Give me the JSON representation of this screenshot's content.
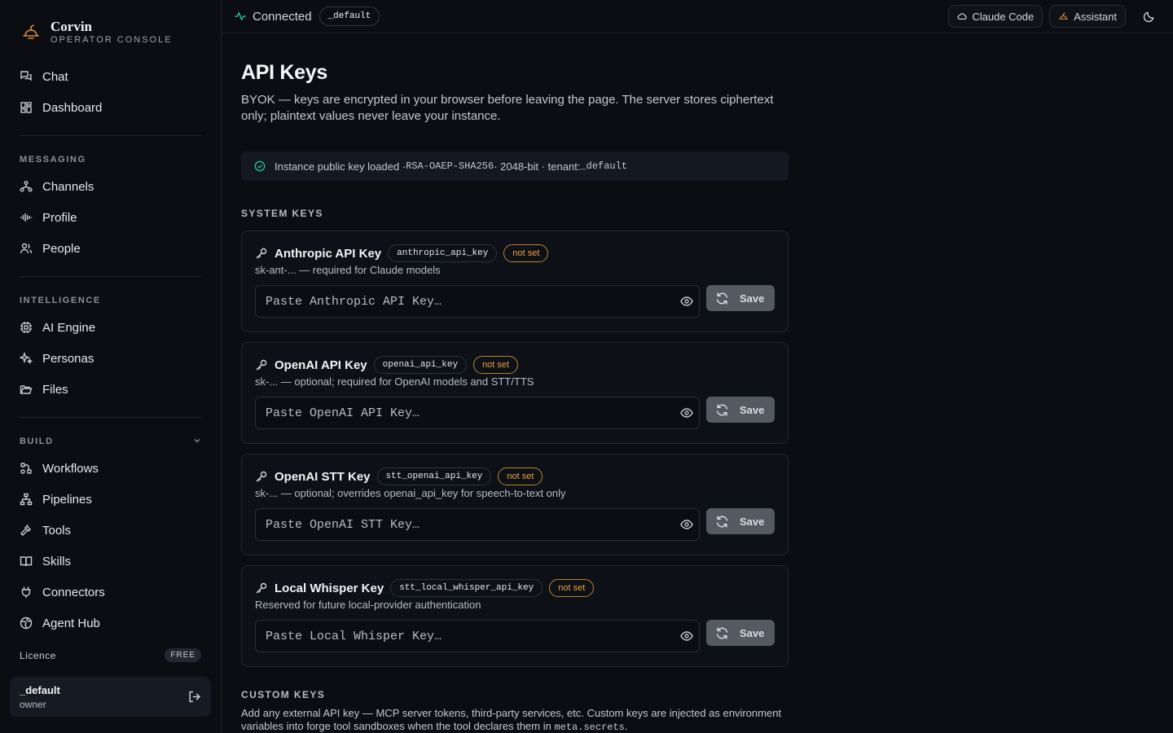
{
  "brand": {
    "name": "Corvin",
    "subtitle": "OPERATOR CONSOLE"
  },
  "sidebar": {
    "top_items": [
      {
        "label": "Chat",
        "icon": "chat-icon"
      },
      {
        "label": "Dashboard",
        "icon": "dashboard-icon"
      }
    ],
    "sections": [
      {
        "title": "MESSAGING",
        "items": [
          {
            "label": "Channels",
            "icon": "channels-icon"
          },
          {
            "label": "Profile",
            "icon": "waveform-icon"
          },
          {
            "label": "People",
            "icon": "people-icon"
          }
        ]
      },
      {
        "title": "INTELLIGENCE",
        "items": [
          {
            "label": "AI Engine",
            "icon": "chip-icon"
          },
          {
            "label": "Personas",
            "icon": "sparkles-icon"
          },
          {
            "label": "Files",
            "icon": "folder-icon"
          }
        ]
      },
      {
        "title": "BUILD",
        "items": [
          {
            "label": "Workflows",
            "icon": "workflow-icon"
          },
          {
            "label": "Pipelines",
            "icon": "pipeline-icon"
          },
          {
            "label": "Tools",
            "icon": "hammer-icon"
          },
          {
            "label": "Skills",
            "icon": "book-icon"
          },
          {
            "label": "Connectors",
            "icon": "plug-icon"
          },
          {
            "label": "Agent Hub",
            "icon": "globe-icon"
          }
        ]
      }
    ],
    "licence_label": "Licence",
    "licence_badge": "FREE",
    "user": {
      "name": "_default",
      "role": "owner"
    }
  },
  "topbar": {
    "status": "Connected",
    "tenant": "_default",
    "claude_code_label": "Claude Code",
    "assistant_label": "Assistant"
  },
  "page": {
    "title": "API Keys",
    "description": "BYOK — keys are encrypted in your browser before leaving the page. The server stores ciphertext only; plaintext values never leave your instance.",
    "notice_prefix": "Instance public key loaded · ",
    "notice_algo": "RSA-OAEP-SHA256",
    "notice_mid": " · 2048-bit · tenant: ",
    "notice_tenant": "_default",
    "system_keys_title": "SYSTEM KEYS",
    "keys": [
      {
        "name": "Anthropic API Key",
        "id": "anthropic_api_key",
        "status": "not set",
        "desc": "sk-ant-... — required for Claude models",
        "placeholder": "Paste Anthropic API Key…",
        "save": "Save"
      },
      {
        "name": "OpenAI API Key",
        "id": "openai_api_key",
        "status": "not set",
        "desc": "sk-... — optional; required for OpenAI models and STT/TTS",
        "placeholder": "Paste OpenAI API Key…",
        "save": "Save"
      },
      {
        "name": "OpenAI STT Key",
        "id": "stt_openai_api_key",
        "status": "not set",
        "desc": "sk-... — optional; overrides openai_api_key for speech-to-text only",
        "placeholder": "Paste OpenAI STT Key…",
        "save": "Save"
      },
      {
        "name": "Local Whisper Key",
        "id": "stt_local_whisper_api_key",
        "status": "not set",
        "desc": "Reserved for future local-provider authentication",
        "placeholder": "Paste Local Whisper Key…",
        "save": "Save"
      }
    ],
    "custom_keys_title": "CUSTOM KEYS",
    "custom_desc_prefix": "Add any external API key — MCP server tokens, third-party services, etc. Custom keys are injected as environment variables into forge tool sandboxes when the tool declares them in ",
    "custom_desc_code": "meta.secrets",
    "custom_desc_suffix": "."
  },
  "colors": {
    "accent_green": "#22c39a",
    "status_orange": "#e8a33a",
    "background": "#0b0d12"
  }
}
